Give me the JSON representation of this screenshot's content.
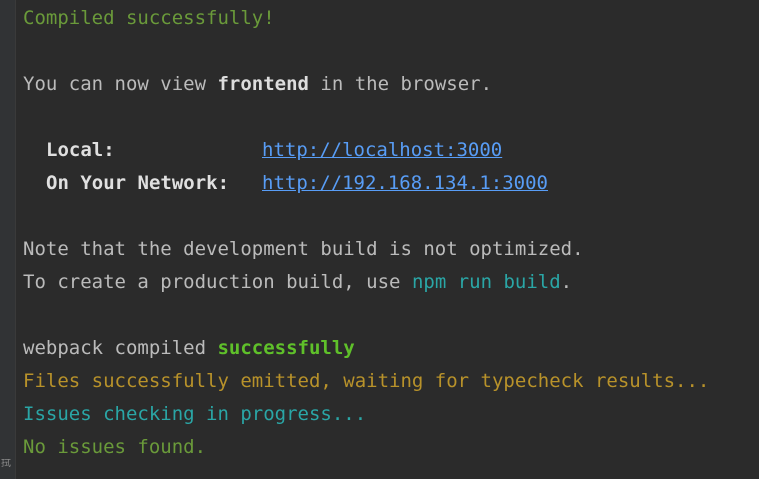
{
  "console": {
    "compiled": "Compiled successfully!",
    "view_prefix": "You can now view ",
    "app_name": "frontend",
    "view_suffix": " in the browser.",
    "local_label": "Local:",
    "local_url": "http://localhost:3000",
    "network_label": "On Your Network:",
    "network_url": "http://192.168.134.1:3000",
    "note_line": "Note that the development build is not optimized.",
    "prod_prefix": "To create a production build, use ",
    "prod_command": "npm run build",
    "prod_suffix": ".",
    "webpack_prefix": "webpack compiled ",
    "webpack_status": "successfully",
    "files_emitted": "Files successfully emitted, waiting for typecheck results...",
    "issues_checking": "Issues checking in progress...",
    "no_issues": "No issues found."
  },
  "gutter": {
    "mark": "拭"
  },
  "colors": {
    "background": "#2b2b2b",
    "success_dim": "#6a9a3a",
    "success_bold": "#5fc02a",
    "link": "#589df6",
    "cyan": "#2aa6a6",
    "warning": "#b8922a",
    "text": "#bbbbbb"
  }
}
